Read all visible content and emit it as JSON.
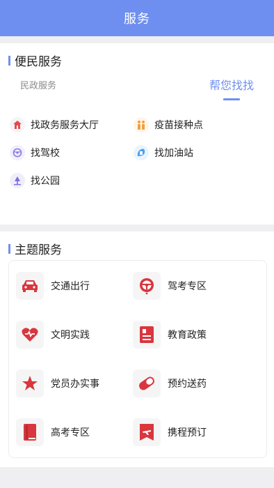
{
  "header": {
    "title": "服务"
  },
  "convenience": {
    "title": "便民服务",
    "tabs": {
      "left": "民政服务",
      "right": "帮您找找"
    },
    "items": [
      {
        "label": "找政务服务大厅",
        "icon": "government-hall-icon",
        "color": "#e54a4a"
      },
      {
        "label": "疫苗接种点",
        "icon": "vaccine-icon",
        "color": "#f0a040"
      },
      {
        "label": "找驾校",
        "icon": "driving-school-icon",
        "color": "#8a77e0"
      },
      {
        "label": "找加油站",
        "icon": "gas-station-icon",
        "color": "#4aa0f0"
      },
      {
        "label": "找公园",
        "icon": "park-icon",
        "color": "#7b6fe0"
      }
    ]
  },
  "themes": {
    "title": "主题服务",
    "items": [
      {
        "label": "交通出行",
        "icon": "car-icon"
      },
      {
        "label": "驾考专区",
        "icon": "steering-wheel-icon"
      },
      {
        "label": "文明实践",
        "icon": "heart-icon"
      },
      {
        "label": "教育政策",
        "icon": "document-icon"
      },
      {
        "label": "党员办实事",
        "icon": "star-icon"
      },
      {
        "label": "预约送药",
        "icon": "pill-icon"
      },
      {
        "label": "高考专区",
        "icon": "book-icon"
      },
      {
        "label": "携程预订",
        "icon": "flight-ticket-icon"
      }
    ],
    "accent": "#d9363e"
  }
}
